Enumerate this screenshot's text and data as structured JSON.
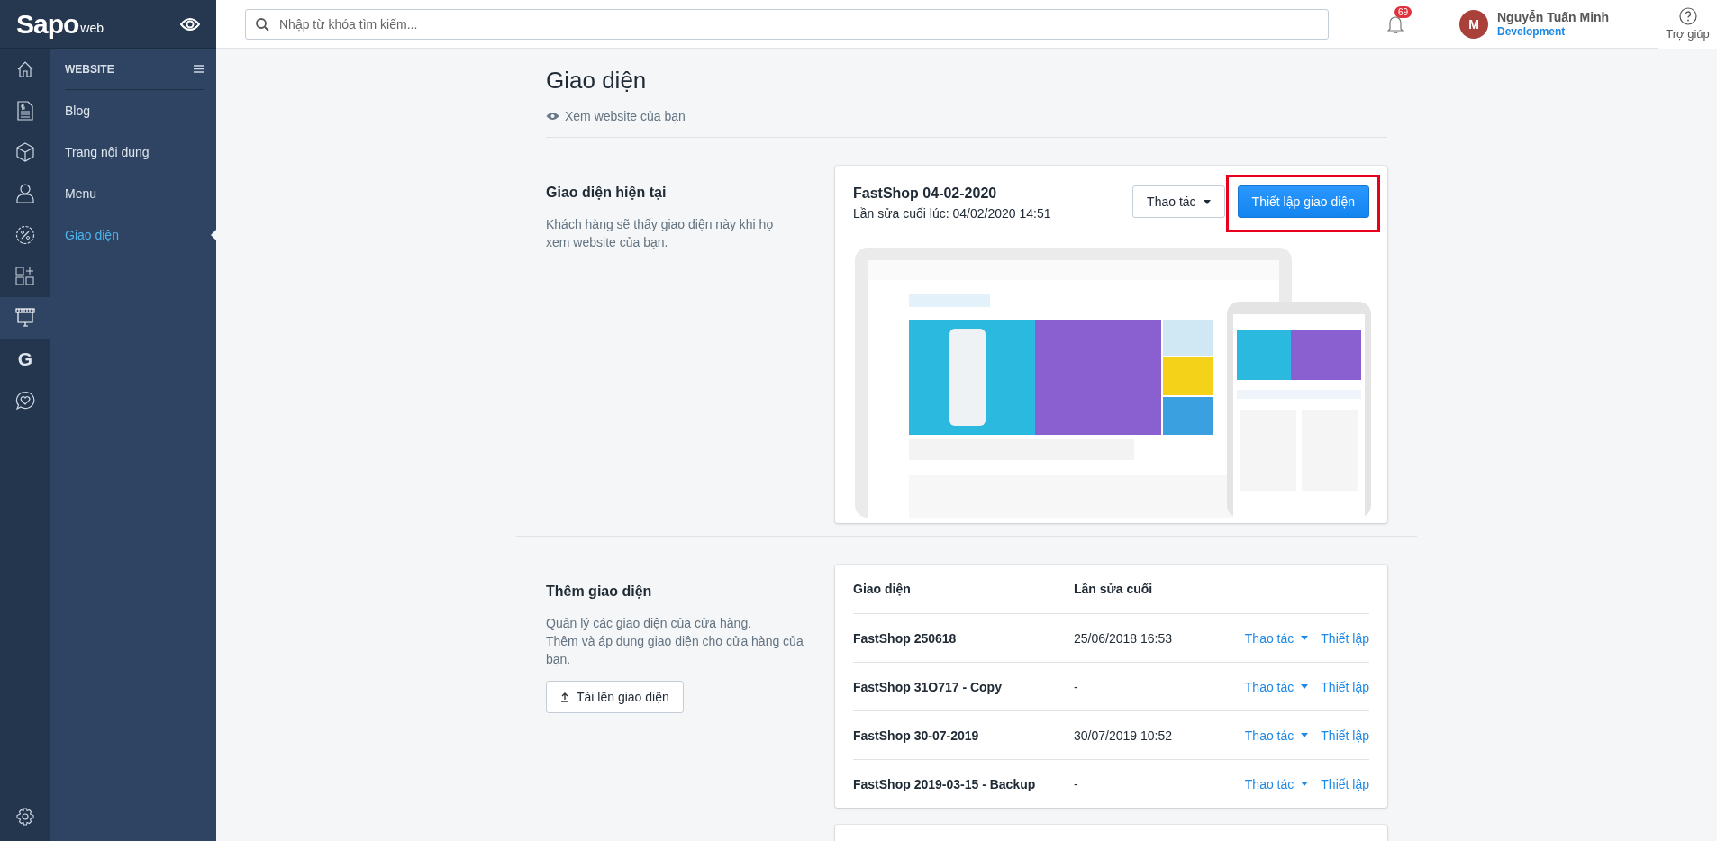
{
  "brand": {
    "logo": "Sapo",
    "suffix": "web"
  },
  "rail": [
    {
      "kind": "home",
      "selected": false
    },
    {
      "kind": "invoice",
      "selected": false
    },
    {
      "kind": "box",
      "selected": false
    },
    {
      "kind": "user",
      "selected": false
    },
    {
      "kind": "percent",
      "selected": false
    },
    {
      "kind": "apps",
      "selected": false
    },
    {
      "kind": "store",
      "selected": true
    },
    {
      "kind": "letter",
      "glyph": "G",
      "selected": false
    },
    {
      "kind": "heart",
      "selected": false
    }
  ],
  "rail_footer": {
    "kind": "settings"
  },
  "nav": {
    "title": "WEBSITE",
    "items": [
      {
        "label": "Blog",
        "selected": false
      },
      {
        "label": "Trang nội dung",
        "selected": false
      },
      {
        "label": "Menu",
        "selected": false
      },
      {
        "label": "Giao diện",
        "selected": true
      }
    ]
  },
  "search": {
    "placeholder": "Nhập từ khóa tìm kiếm..."
  },
  "notifications": {
    "count": "69"
  },
  "user": {
    "initial": "M",
    "name": "Nguyễn Tuấn Minh",
    "role": "Development"
  },
  "help": {
    "label": "Trợ giúp"
  },
  "page": {
    "title": "Giao diện",
    "view_link": "Xem website của bạn"
  },
  "current": {
    "heading": "Giao diện hiện tại",
    "description": "Khách hàng sẽ thấy giao diện này khi họ xem website của bạn.",
    "theme_name": "FastShop 04-02-2020",
    "edited": "Lần sửa cuối lúc: 04/02/2020 14:51",
    "actions_label": "Thao tác",
    "customize_label": "Thiết lập giao diện",
    "highlighted": true
  },
  "library": {
    "heading": "Thêm giao diện",
    "description": "Quản lý các giao diện của cửa hàng.\nThêm và áp dụng giao diện cho cửa hàng của bạn.",
    "upload_label": "Tải lên giao diện",
    "columns": [
      "Giao diện",
      "Lần sửa cuối"
    ],
    "rows": [
      {
        "name": "FastShop 250618",
        "edited": "25/06/2018 16:53",
        "actions": "Thao tác",
        "customize": "Thiết lập"
      },
      {
        "name": "FastShop 31O717 - Copy",
        "edited": "-",
        "actions": "Thao tác",
        "customize": "Thiết lập"
      },
      {
        "name": "FastShop 30-07-2019",
        "edited": "30/07/2019 10:52",
        "actions": "Thao tác",
        "customize": "Thiết lập"
      },
      {
        "name": "FastShop 2019-03-15 - Backup",
        "edited": "-",
        "actions": "Thao tác",
        "customize": "Thiết lập"
      }
    ]
  }
}
